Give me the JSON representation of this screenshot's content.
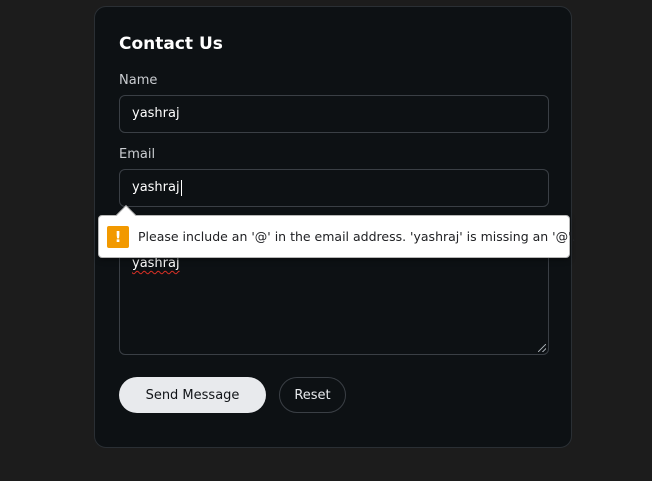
{
  "form": {
    "title": "Contact Us",
    "name_label": "Name",
    "name_value": "yashraj",
    "email_label": "Email",
    "email_value": "yashraj",
    "message_value": "yashraj",
    "send_label": "Send Message",
    "reset_label": "Reset"
  },
  "validation": {
    "icon": "warning-icon",
    "icon_glyph": "!",
    "message": "Please include an '@' in the email address. 'yashraj' is missing an '@'."
  },
  "colors": {
    "page_background": "#1c1c1c",
    "card_background": "#0d1114",
    "primary_button": "#e8eaed",
    "warning": "#f29900"
  }
}
